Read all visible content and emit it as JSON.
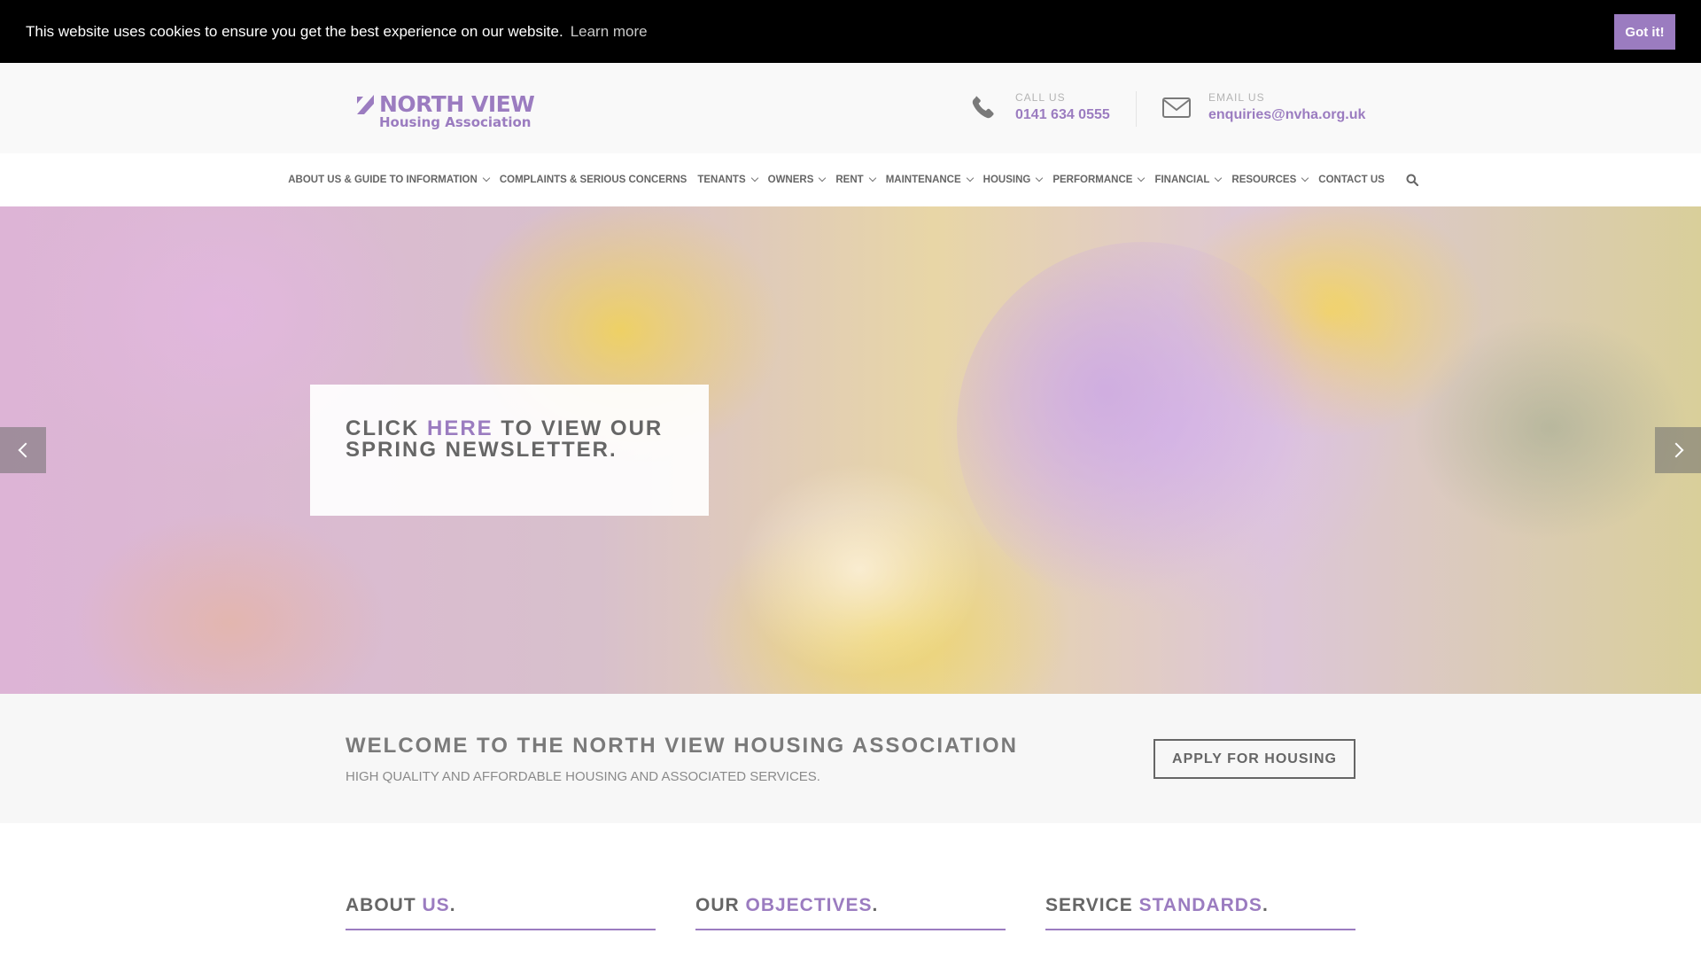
{
  "cookie": {
    "message": "This website uses cookies to ensure you get the best experience on our website.",
    "learn_more": "Learn more",
    "accept": "Got it!"
  },
  "header": {
    "logo_title": "NORTH VIEW",
    "logo_subtitle": "Housing Association",
    "call_label": "CALL US",
    "call_value": "0141 634 0555",
    "email_label": "EMAIL US",
    "email_value": "enquiries@nvha.org.uk",
    "call_icon": "phone-icon",
    "email_icon": "envelope-icon"
  },
  "nav": {
    "items": [
      {
        "label": "ABOUT US & GUIDE TO INFORMATION",
        "dropdown": true
      },
      {
        "label": "COMPLAINTS & SERIOUS CONCERNS",
        "dropdown": false
      },
      {
        "label": "TENANTS",
        "dropdown": true
      },
      {
        "label": "OWNERS",
        "dropdown": true
      },
      {
        "label": "RENT",
        "dropdown": true
      },
      {
        "label": "MAINTENANCE",
        "dropdown": true
      },
      {
        "label": "HOUSING",
        "dropdown": true
      },
      {
        "label": "PERFORMANCE",
        "dropdown": true
      },
      {
        "label": "FINANCIAL",
        "dropdown": true
      },
      {
        "label": "RESOURCES",
        "dropdown": true
      },
      {
        "label": "CONTACT US",
        "dropdown": false
      }
    ],
    "search_icon": "search-icon"
  },
  "hero": {
    "text_before": "CLICK ",
    "link_text": "HERE",
    "text_after": " TO VIEW OUR SPRING NEWSLETTER.",
    "prev_icon": "chevron-left-icon",
    "next_icon": "chevron-right-icon"
  },
  "welcome": {
    "title": "WELCOME TO THE NORTH VIEW HOUSING ASSOCIATION",
    "subtitle": "HIGH QUALITY AND AFFORDABLE HOUSING AND ASSOCIATED SERVICES.",
    "apply_button": "APPLY FOR HOUSING"
  },
  "columns": [
    {
      "title_plain": "ABOUT ",
      "title_accent": "US",
      "title_end": "."
    },
    {
      "title_plain": "OUR ",
      "title_accent": "OBJECTIVES",
      "title_end": "."
    },
    {
      "title_plain": "SERVICE ",
      "title_accent": "STANDARDS",
      "title_end": "."
    }
  ],
  "colors": {
    "accent": "#9b7cc0",
    "cookie_bg": "#000000",
    "text": "#666666"
  }
}
